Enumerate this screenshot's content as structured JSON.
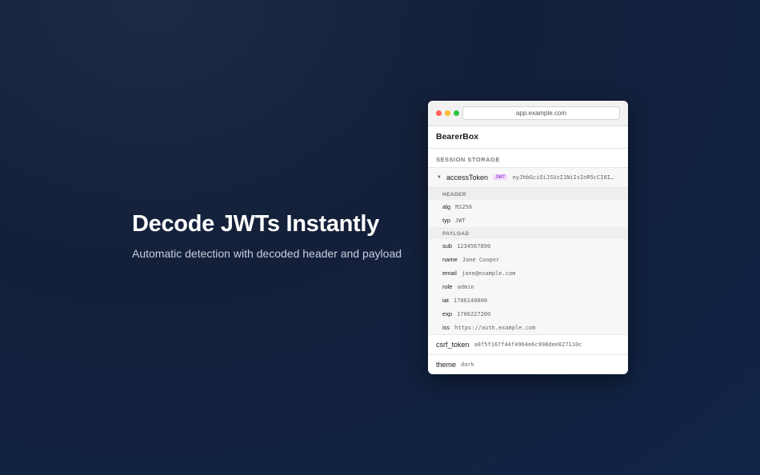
{
  "hero": {
    "title": "Decode JWTs Instantly",
    "subtitle": "Automatic detection with decoded header and payload"
  },
  "window": {
    "url": "app.example.com",
    "app_name": "BearerBox",
    "section_label": "SESSION STORAGE",
    "jwt_item": {
      "caret": "▼",
      "key": "accessToken",
      "badge": "JWT",
      "value": "eyJhbGciOiJSUzI1NiIsInR5cCI6I…",
      "header_label": "HEADER",
      "header": [
        {
          "key": "alg",
          "value": "RS256"
        },
        {
          "key": "typ",
          "value": "JWT"
        }
      ],
      "payload_label": "PAYLOAD",
      "payload": [
        {
          "key": "sub",
          "value": "1234567890"
        },
        {
          "key": "name",
          "value": "Jane Cooper"
        },
        {
          "key": "email",
          "value": "jane@example.com"
        },
        {
          "key": "role",
          "value": "admin"
        },
        {
          "key": "iat",
          "value": "1706140800"
        },
        {
          "key": "exp",
          "value": "1706227200"
        },
        {
          "key": "iss",
          "value": "https://auth.example.com"
        }
      ]
    },
    "items": [
      {
        "key": "csrf_token",
        "value": "a8f5f167f44f4964e6c998dee827110c"
      },
      {
        "key": "theme",
        "value": "dark"
      }
    ]
  },
  "colors": {
    "badge_text": "#a03fd6",
    "badge_bg": "#f3e4fb",
    "close": "#ff5f57",
    "minimize": "#febc2e",
    "zoom": "#28c840"
  }
}
